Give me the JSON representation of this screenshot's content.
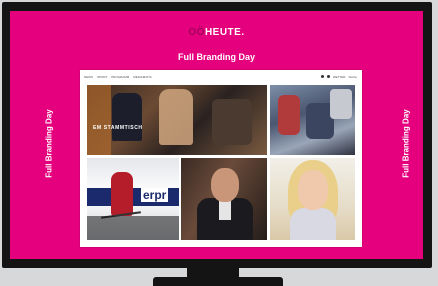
{
  "logo": {
    "part1": "OÖ",
    "part2": "HEUTE."
  },
  "banner": {
    "top": "Full Branding Day",
    "left": "Full Branding Day",
    "right": "Full Branding Day"
  },
  "site": {
    "nav": {
      "items": [
        "NEWS",
        "SPORT",
        "PROGRAMM",
        "MEDIAMATIC"
      ],
      "right": [
        "WETTER",
        "Suche"
      ]
    },
    "tiles": [
      {
        "caption": "EM STAMMTISCH",
        "sub": ""
      },
      {
        "caption": "",
        "sub": ""
      },
      {
        "caption": "",
        "sub": ""
      },
      {
        "caption": "",
        "sub": ""
      },
      {
        "caption": "",
        "sub": ""
      }
    ],
    "ad_brand": "erpr"
  },
  "colors": {
    "brand": "#e5007e",
    "frame": "#141414",
    "background": "#d7d8da"
  }
}
